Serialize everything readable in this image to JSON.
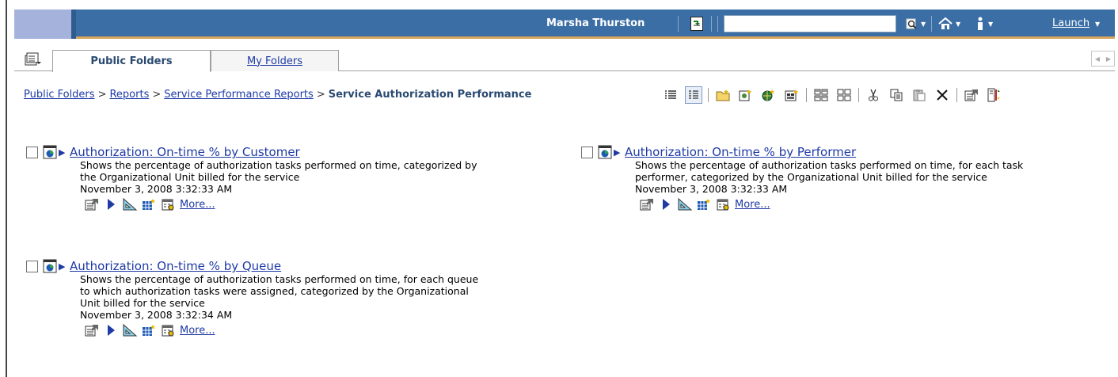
{
  "header": {
    "user_name": "Marsha Thurston",
    "search_value": "",
    "launch_label": "Launch"
  },
  "tabs": [
    {
      "label": "Public Folders",
      "active": true
    },
    {
      "label": "My Folders",
      "active": false
    }
  ],
  "breadcrumb": {
    "items": [
      "Public Folders",
      "Reports",
      "Service Performance Reports"
    ],
    "current": "Service Authorization Performance",
    "separator": ">"
  },
  "toolbar": {
    "icons": [
      "list-view-icon",
      "details-view-icon",
      "new-folder-icon",
      "new-job-icon",
      "new-url-icon",
      "new-page-icon",
      "properties-icon",
      "order-icon",
      "cut-icon",
      "copy-icon",
      "paste-icon",
      "delete-icon",
      "set-properties-icon",
      "run-icon"
    ]
  },
  "reports": [
    {
      "title": "Authorization: On-time % by Customer",
      "description_lines": [
        "Shows the percentage of authorization tasks performed on time, categorized by",
        "the Organizational Unit billed for the service"
      ],
      "date": "November 3, 2008 3:32:33 AM",
      "more_label": "More..."
    },
    {
      "title": "Authorization: On-time % by Performer",
      "description_lines": [
        "Shows the percentage of authorization tasks performed on time, for each task",
        "performer, categorized by the Organizational Unit billed for the service"
      ],
      "date": "November 3, 2008 3:32:33 AM",
      "more_label": "More..."
    },
    {
      "title": "Authorization: On-time % by Queue",
      "description_lines": [
        "Shows the percentage of authorization tasks performed on time, for each queue",
        "to which authorization tasks were assigned, categorized by the Organizational",
        "Unit billed for the service"
      ],
      "date": "November 3, 2008 3:32:34 AM",
      "more_label": "More..."
    }
  ],
  "colors": {
    "banner": "#3a6ea5",
    "banner_accent": "#d7a55b",
    "link": "#1e3aa5"
  }
}
